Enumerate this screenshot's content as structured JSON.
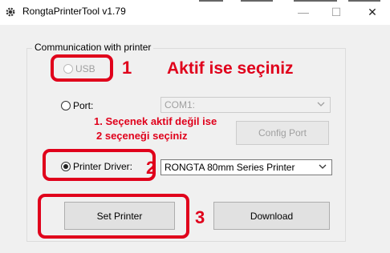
{
  "window": {
    "title": "RongtaPrinterTool v1.79",
    "minimize_glyph": "—",
    "maximize_glyph": "☐",
    "close_glyph": "✕"
  },
  "group": {
    "label": "Communication with printer"
  },
  "usb": {
    "label": "USB",
    "enabled": false,
    "checked": false
  },
  "port": {
    "label": "Port:",
    "checked": false,
    "selected": "COM1:",
    "enabled": false
  },
  "config_port": {
    "label": "Config Port",
    "enabled": false
  },
  "printer_driver": {
    "label": "Printer Driver:",
    "checked": true,
    "selected": "RONGTA 80mm Series Printer"
  },
  "buttons": {
    "set_printer": "Set Printer",
    "download": "Download"
  },
  "annotations": {
    "num1": "1",
    "num2": "2",
    "num3": "3",
    "aktif": "Aktif ise seçiniz",
    "note_line1": "1. Seçenek aktif değil ise",
    "note_line2": "2 seçeneği seçiniz",
    "color": "#e0001b"
  }
}
